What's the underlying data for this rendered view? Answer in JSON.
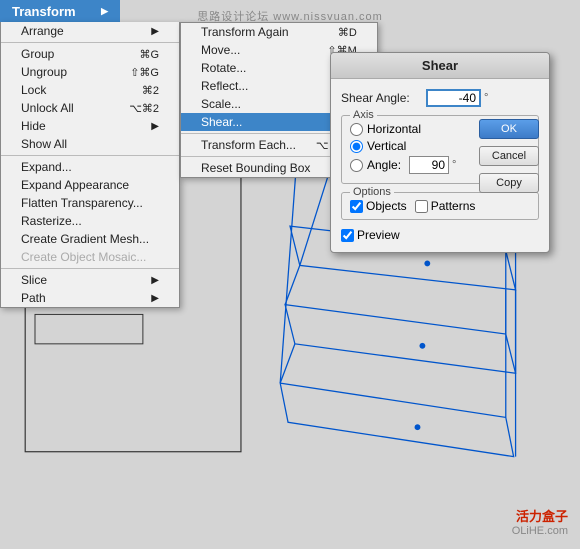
{
  "watermark": {
    "top": "思路设计论坛 www.nissvuan.com",
    "bottom_red": "活力盒子",
    "bottom_gray": "OLiHE.com"
  },
  "transform_menu": {
    "header": "Transform",
    "arrow": "▶",
    "items": [
      {
        "label": "Arrange",
        "shortcut": "",
        "arrow": "▶",
        "disabled": false,
        "separator_after": true
      },
      {
        "label": "Group",
        "shortcut": "⌘G",
        "disabled": false
      },
      {
        "label": "Ungroup",
        "shortcut": "⇧⌘G",
        "disabled": false
      },
      {
        "label": "Lock",
        "shortcut": "⌘2",
        "disabled": false
      },
      {
        "label": "Unlock All",
        "shortcut": "⌥⌘2",
        "disabled": false
      },
      {
        "label": "Hide",
        "shortcut": "",
        "disabled": false
      },
      {
        "label": "Show All",
        "shortcut": "",
        "disabled": false,
        "separator_after": true
      },
      {
        "label": "Expand...",
        "shortcut": "",
        "disabled": false
      },
      {
        "label": "Expand Appearance",
        "shortcut": "",
        "disabled": false
      },
      {
        "label": "Flatten Transparency...",
        "shortcut": "",
        "disabled": false
      },
      {
        "label": "Rasterize...",
        "shortcut": "",
        "disabled": false
      },
      {
        "label": "Create Gradient Mesh...",
        "shortcut": "",
        "disabled": false
      },
      {
        "label": "Create Object Mosaic...",
        "shortcut": "",
        "disabled": true,
        "separator_after": true
      },
      {
        "label": "Slice",
        "shortcut": "",
        "arrow": "▶",
        "disabled": false
      },
      {
        "label": "Path",
        "shortcut": "",
        "arrow": "▶",
        "disabled": false
      }
    ]
  },
  "submenu": {
    "items": [
      {
        "label": "Transform Again",
        "shortcut": "⌘D",
        "selected": false
      },
      {
        "label": "Move...",
        "shortcut": "⇧⌘M",
        "selected": false
      },
      {
        "label": "Rotate...",
        "shortcut": "",
        "selected": false
      },
      {
        "label": "Reflect...",
        "shortcut": "",
        "selected": false
      },
      {
        "label": "Scale...",
        "shortcut": "",
        "selected": false
      },
      {
        "label": "Shear...",
        "shortcut": "",
        "selected": true,
        "separator_after": true
      },
      {
        "label": "Transform Each...",
        "shortcut": "⌥⇧⌘D",
        "selected": false,
        "separator_after": true
      },
      {
        "label": "Reset Bounding Box",
        "shortcut": "",
        "selected": false
      }
    ]
  },
  "shear_dialog": {
    "title": "Shear",
    "shear_angle_label": "Shear Angle:",
    "shear_angle_value": "-40",
    "degree_symbol": "°",
    "axis_label": "Axis",
    "horizontal_label": "Horizontal",
    "vertical_label": "Vertical",
    "angle_label": "Angle:",
    "angle_value": "90",
    "options_label": "Options",
    "objects_label": "Objects",
    "patterns_label": "Patterns",
    "preview_label": "Preview",
    "ok_label": "OK",
    "cancel_label": "Cancel",
    "copy_label": "Copy"
  }
}
